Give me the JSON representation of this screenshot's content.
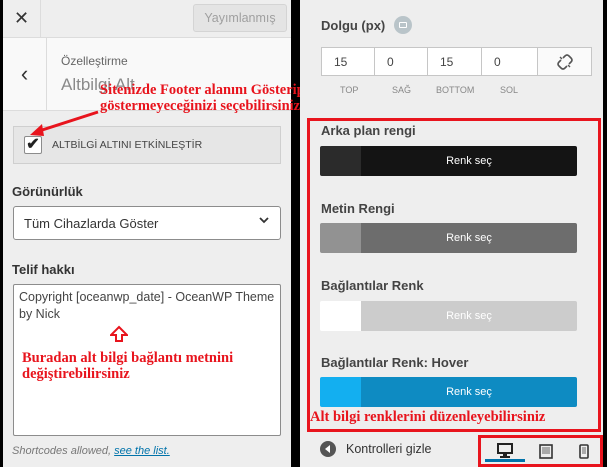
{
  "header": {
    "close_icon": "✕",
    "publish_label": "Yayımlanmış"
  },
  "breadcrumb": {
    "back_icon": "‹",
    "section": "Özelleştirme",
    "title": "Altbilgi Alt"
  },
  "footer_toggle": {
    "label": "ALTBİLGİ ALTINI ETKİNLEŞTİR",
    "checked": true,
    "check_glyph": "✔"
  },
  "visibility": {
    "label": "Görünürlük",
    "selected": "Tüm Cihazlarda Göster",
    "chevron_icon": "⌄"
  },
  "copyright": {
    "label": "Telif hakkı",
    "value": "Copyright [oceanwp_date] - OceanWP Theme by Nick",
    "note_prefix": "Shortcodes allowed,",
    "note_link": "see the list."
  },
  "annotations": {
    "toggle_note": "Sitenizde Footer alanını Gösterip göstermeyeceğinizi seçebilirsiniz",
    "text_note": "Buradan alt bilgi bağlantı metnini değiştirebilirsiniz",
    "colors_note": "Alt bilgi renklerini düzenleyebilirsiniz",
    "arrow_color": "#e8141d"
  },
  "padding": {
    "label": "Dolgu (px)",
    "fields": [
      {
        "value": "15",
        "caption": "TOP"
      },
      {
        "value": "0",
        "caption": "SAĞ"
      },
      {
        "value": "15",
        "caption": "BOTTOM"
      },
      {
        "value": "0",
        "caption": "SOL"
      }
    ],
    "link_icon": "unlink-icon"
  },
  "colors": [
    {
      "label": "Arka plan rengi",
      "button": "Renk seç",
      "chip": "#2b2b2b",
      "fill": "#141414"
    },
    {
      "label": "Metin Rengi",
      "button": "Renk seç",
      "chip": "#929292",
      "fill": "#6d6d6d"
    },
    {
      "label": "Bağlantılar Renk",
      "button": "Renk seç",
      "chip": "#ffffff",
      "fill": "#cccccc"
    },
    {
      "label": "Bağlantılar Renk: Hover",
      "button": "Renk seç",
      "chip": "#13aff0",
      "fill": "#0e8bc2"
    }
  ],
  "controls": {
    "hide_label": "Kontrolleri gizle",
    "devices": [
      "desktop-icon",
      "tablet-icon",
      "mobile-icon"
    ]
  }
}
